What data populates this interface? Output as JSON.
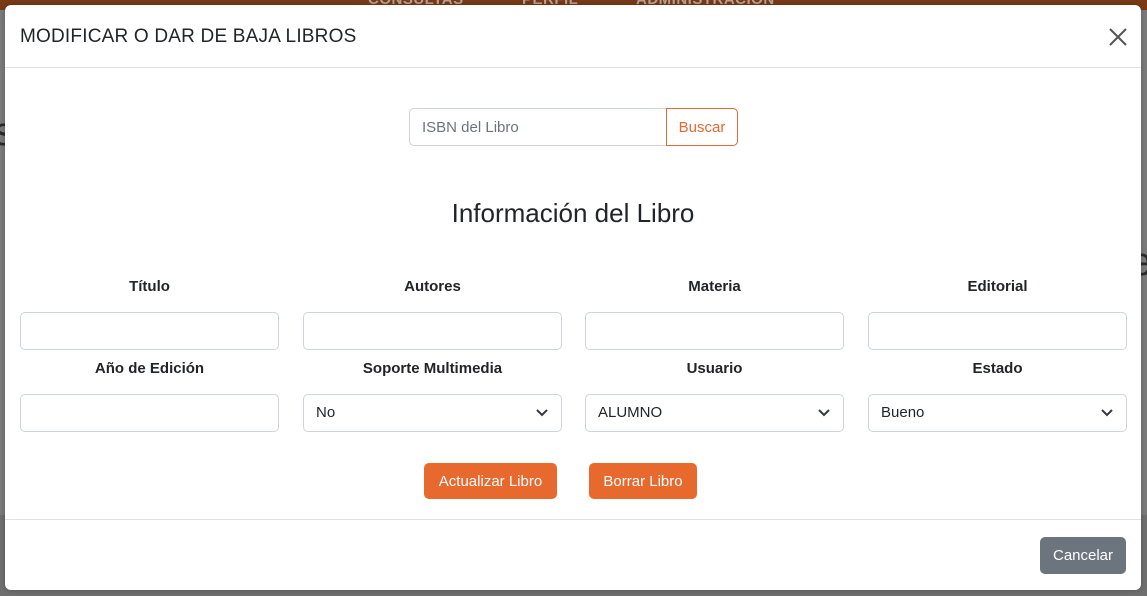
{
  "background": {
    "nav_items": [
      "CONSULTAS",
      "PERFIL",
      "ADMINISTRACIÓN"
    ]
  },
  "modal": {
    "title": "MODIFICAR O DAR DE BAJA LIBROS",
    "close_icon": "close-icon",
    "search": {
      "placeholder": "ISBN del Libro",
      "value": "",
      "button_label": "Buscar"
    },
    "section_title": "Información del Libro",
    "fields": {
      "titulo": {
        "label": "Título",
        "value": ""
      },
      "autores": {
        "label": "Autores",
        "value": ""
      },
      "materia": {
        "label": "Materia",
        "value": ""
      },
      "editorial": {
        "label": "Editorial",
        "value": ""
      },
      "anio": {
        "label": "Año de Edición",
        "value": ""
      },
      "soporte": {
        "label": "Soporte Multimedia",
        "value": "No"
      },
      "usuario": {
        "label": "Usuario",
        "value": "ALUMNO"
      },
      "estado": {
        "label": "Estado",
        "value": "Bueno"
      }
    },
    "actions": {
      "update_label": "Actualizar Libro",
      "delete_label": "Borrar Libro"
    },
    "footer": {
      "cancel_label": "Cancelar"
    },
    "colors": {
      "accent": "#e8692e",
      "secondary": "#6c757d",
      "navbar": "#7a3a15"
    }
  }
}
